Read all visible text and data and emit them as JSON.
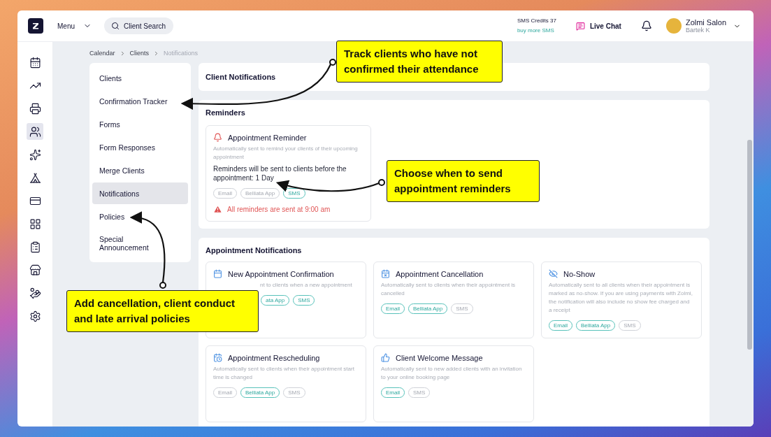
{
  "topbar": {
    "menu": "Menu",
    "search": {
      "placeholder": "Client Search"
    },
    "sms_credits": "SMS Credits 37",
    "buy_sms": "buy more SMS",
    "live_chat": "Live Chat",
    "user_name": "Zolmi Salon",
    "user_sub": "Bartek K"
  },
  "rail": [
    {
      "selected": false
    },
    {
      "selected": false
    },
    {
      "selected": false
    },
    {
      "selected": true
    },
    {
      "selected": false
    },
    {
      "selected": false
    },
    {
      "selected": false
    },
    {
      "selected": false
    },
    {
      "selected": false
    },
    {
      "selected": false
    },
    {
      "selected": false
    },
    {
      "selected": false
    }
  ],
  "breadcrumb": [
    {
      "label": "Calendar",
      "current": false
    },
    {
      "label": "Clients",
      "current": false
    },
    {
      "label": "Notifications",
      "current": true
    }
  ],
  "nav": [
    {
      "label": "Clients",
      "selected": false
    },
    {
      "label": "Confirmation Tracker",
      "selected": false
    },
    {
      "label": "Forms",
      "selected": false
    },
    {
      "label": "Form Responses",
      "selected": false
    },
    {
      "label": "Merge Clients",
      "selected": false
    },
    {
      "label": "Notifications",
      "selected": true
    },
    {
      "label": "Policies",
      "selected": false
    },
    {
      "label": "Special Announcement",
      "selected": false
    }
  ],
  "header": "Client Notifications",
  "reminders": {
    "title": "Reminders",
    "card": {
      "title": "Appointment Reminder",
      "description": "Automatically sent to remind your clients of their upcoming appointment",
      "detail": "Reminders will be sent to clients before the appointment: 1 Day",
      "channels": [
        {
          "label": "Email",
          "on": false
        },
        {
          "label": "Belliata App",
          "on": false
        },
        {
          "label": "SMS",
          "on": true
        }
      ],
      "warning": "All reminders are sent at 9:00 am"
    }
  },
  "appointment_notifications": {
    "title": "Appointment Notifications",
    "cards": [
      {
        "kind": "covered",
        "title": "New Appointment Confirmation",
        "description": "nt to clients when a new appointment",
        "channels": [
          {
            "label": "ata App",
            "on": true
          },
          {
            "label": "SMS",
            "on": true
          }
        ]
      },
      {
        "kind": "normal",
        "title": "Appointment Cancellation",
        "description": "Automatically sent to clients when their appointment is cancelled",
        "channels": [
          {
            "label": "Email",
            "on": true
          },
          {
            "label": "Belliata App",
            "on": true
          },
          {
            "label": "SMS",
            "on": false
          }
        ]
      },
      {
        "kind": "normal",
        "title": "No-Show",
        "description": "Automatically sent to all clients when their appointment is marked as no-show. If you are using payments with Zolmi, the notification will also include no show fee charged and a receipt",
        "channels": [
          {
            "label": "Email",
            "on": true
          },
          {
            "label": "Belliata App",
            "on": true
          },
          {
            "label": "SMS",
            "on": false
          }
        ]
      },
      {
        "kind": "normal",
        "title": "Appointment Rescheduling",
        "description": "Automatically sent to clients when their appointment start time is changed",
        "channels": [
          {
            "label": "Email",
            "on": false
          },
          {
            "label": "Belliata App",
            "on": true
          },
          {
            "label": "SMS",
            "on": false
          }
        ]
      },
      {
        "kind": "normal",
        "title": "Client Welcome Message",
        "description": "Automatically sent to new added clients with an invitation to your online booking page",
        "channels": [
          {
            "label": "Email",
            "on": true
          },
          {
            "label": "SMS",
            "on": false
          }
        ]
      }
    ]
  },
  "callouts": [
    "Track clients who have not confirmed their attendance",
    "Choose when to send appointment reminders",
    "Add cancellation, client conduct and late arrival policies"
  ]
}
